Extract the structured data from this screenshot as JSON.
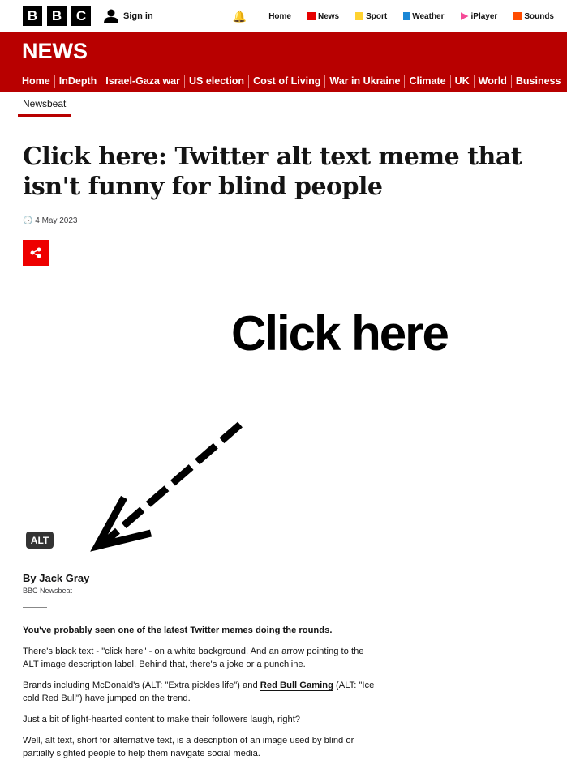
{
  "masthead": {
    "logo": [
      "B",
      "B",
      "C"
    ],
    "sign_in": "Sign in",
    "links": [
      {
        "label": "Home",
        "icon": "none",
        "color": ""
      },
      {
        "label": "News",
        "icon": "news-icon",
        "color": "#e60000"
      },
      {
        "label": "Sport",
        "icon": "sport-icon",
        "color": "#ffd230"
      },
      {
        "label": "Weather",
        "icon": "weather-icon",
        "color": "#1a87d6"
      },
      {
        "label": "iPlayer",
        "icon": "iplayer-icon",
        "color": "#f54997"
      },
      {
        "label": "Sounds",
        "icon": "sounds-icon",
        "color": "#ff4c00"
      }
    ]
  },
  "brand": "NEWS",
  "nav": [
    "Home",
    "InDepth",
    "Israel-Gaza war",
    "US election",
    "Cost of Living",
    "War in Ukraine",
    "Climate",
    "UK",
    "World",
    "Business"
  ],
  "section": "Newsbeat",
  "article": {
    "title": "Click here: Twitter alt text meme that isn't funny for blind people",
    "date": "4 May 2023",
    "image": {
      "text": "Click here",
      "badge": "ALT"
    },
    "author": "By Jack Gray",
    "org": "BBC Newsbeat",
    "p1": "You've probably seen one of the latest Twitter memes doing the rounds.",
    "p2": "There's black text - \"click here\" - on a white background. And an arrow pointing to the ALT image description label. Behind that, there's a joke or a punchline.",
    "p3a": "Brands including McDonald's (ALT: \"Extra pickles life\") and ",
    "p3link": "Red Bull Gaming",
    "p3b": " (ALT: \"Ice cold Red Bull\") have jumped on the trend.",
    "p4": "Just a bit of light-hearted content to make their followers laugh, right?",
    "p5": "Well, alt text, short for alternative text, is a description of an image used by blind or partially sighted people to help them navigate social media."
  },
  "colors": {
    "brand_red": "#b80000",
    "share_red": "#e00000"
  }
}
